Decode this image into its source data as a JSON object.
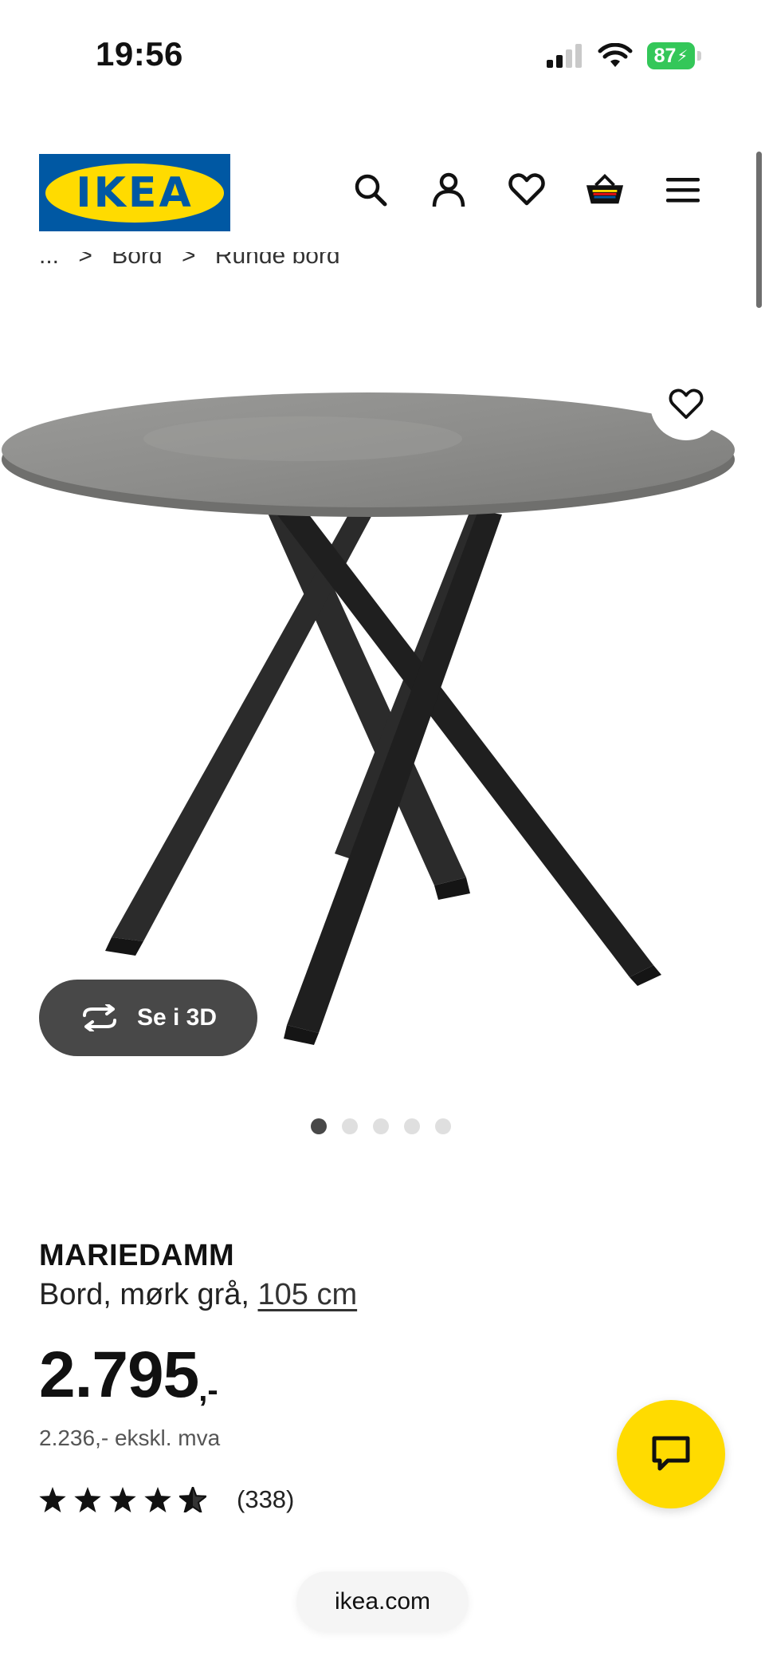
{
  "status_bar": {
    "time": "19:56",
    "battery": "87"
  },
  "header": {
    "logo_text": "IKEA",
    "icons": [
      "search-icon",
      "account-icon",
      "favorites-heart-icon",
      "basket-icon",
      "menu-icon"
    ]
  },
  "breadcrumb": {
    "items": [
      "...",
      "Bord",
      "Runde bord"
    ],
    "separator": ">"
  },
  "gallery": {
    "view_3d_label": "Se i 3D",
    "image_count": 5,
    "active_index": 0
  },
  "product": {
    "name": "MARIEDAMM",
    "description": "Bord, mørk grå, ",
    "size_link": "105 cm",
    "price": "2.795",
    "price_suffix": ",-",
    "price_excl": "2.236,- ekskl. mva",
    "rating": 4.5,
    "review_count": "(338)"
  },
  "browser": {
    "url": "ikea.com"
  },
  "colors": {
    "ikea_blue": "#0058a3",
    "ikea_yellow": "#ffdb00",
    "battery_green": "#34c759"
  }
}
